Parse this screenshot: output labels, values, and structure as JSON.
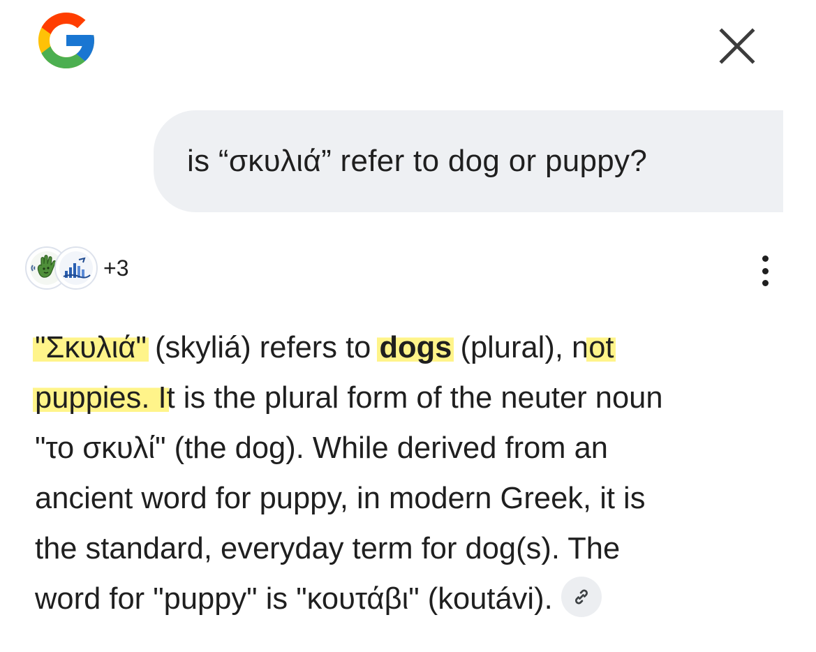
{
  "header": {
    "logo_icon": "google-g-logo",
    "close_icon": "close-icon"
  },
  "query": {
    "text": "is “σκυλιά” refer to dog or puppy?"
  },
  "sources": {
    "count_label": "+3",
    "avatars": [
      "green-hand-logo-icon",
      "blue-chart-logo-icon"
    ]
  },
  "menu": {
    "icon": "more-vert-icon"
  },
  "answer": {
    "l1_q1": "\"",
    "l1_hl1": "Σκυλιά\"",
    "l1_a": " (skyliá) refers to ",
    "l1_bold": "dogs",
    "l1_b": " (plural), n",
    "l1_hl2": "ot",
    "l2_hl": "puppies. I",
    "l2_rest": "t is the plural form of the neuter noun",
    "l3": "\"το σκυλί\" (the dog). While derived from an",
    "l4": "ancient word for puppy, in modern Greek, it is",
    "l5": "the standard, everyday term for dog(s). The",
    "l6": "word for \"puppy\" is \"κουτάβι\" (koutávi).",
    "link_icon": "link-icon"
  },
  "colors": {
    "highlight": "#fff48a",
    "bubble": "#eef0f3",
    "text": "#1f1f1f"
  }
}
